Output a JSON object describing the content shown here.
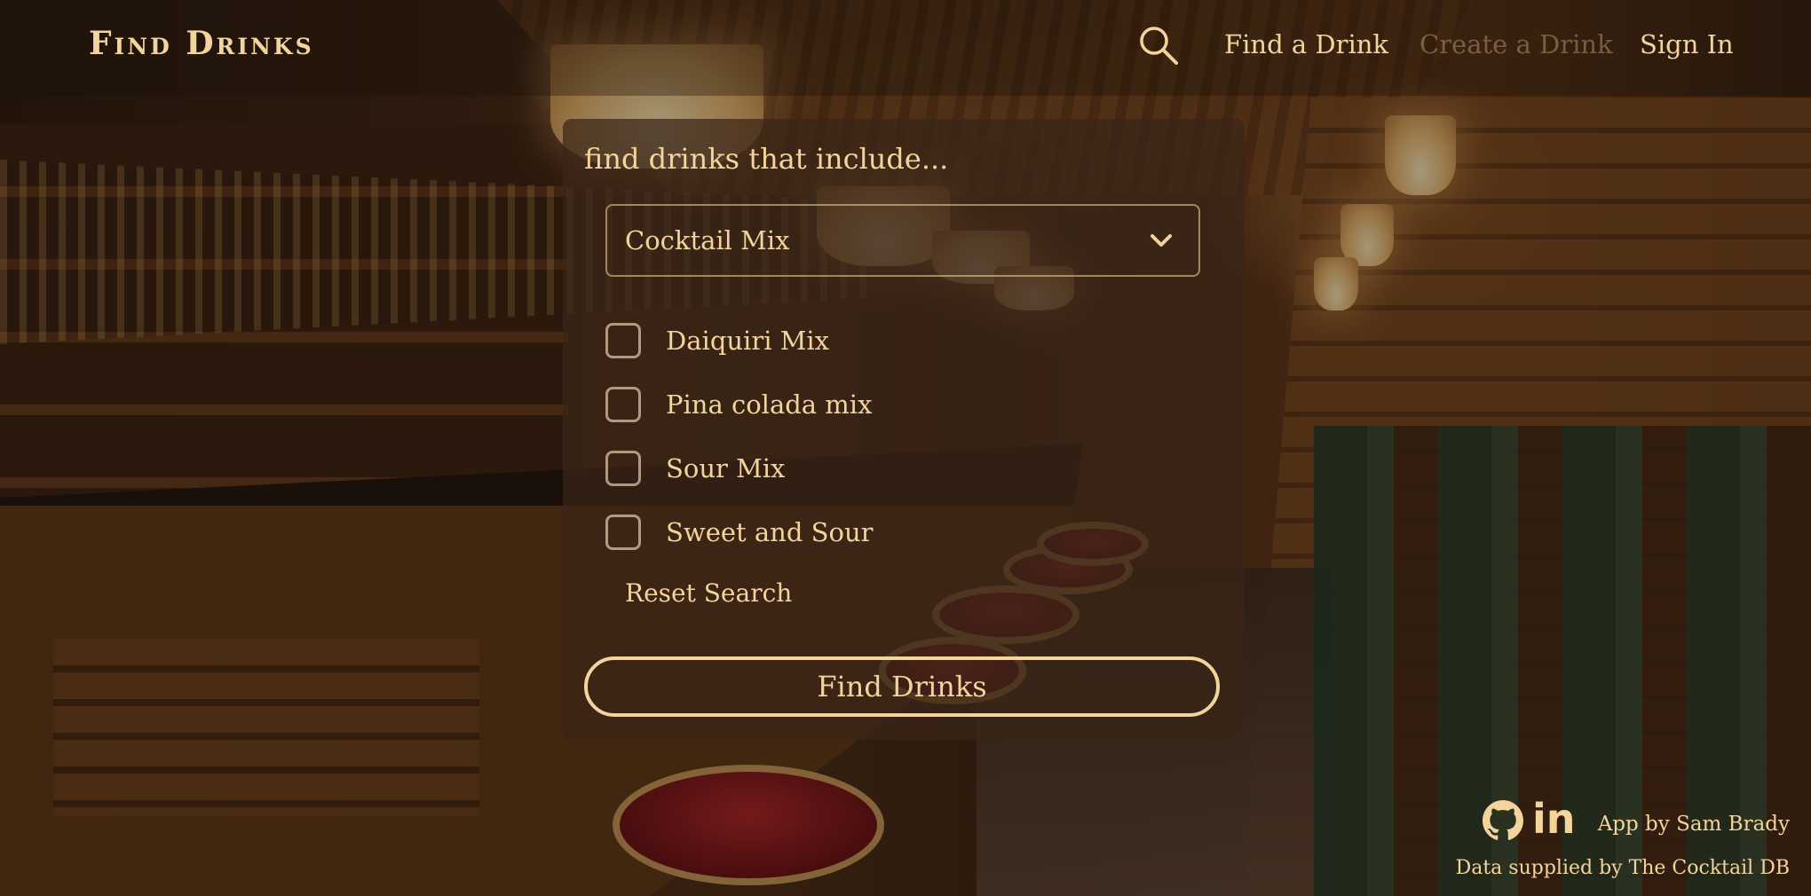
{
  "header": {
    "logo": "Find Drinks",
    "nav": [
      {
        "label": "Find a Drink"
      },
      {
        "label": "Create a Drink"
      },
      {
        "label": "Sign In"
      }
    ]
  },
  "search": {
    "title": "find drinks that include...",
    "category": {
      "selected": "Cocktail Mix"
    },
    "ingredients": [
      {
        "label": "Daiquiri Mix",
        "checked": false
      },
      {
        "label": "Pina colada mix",
        "checked": false
      },
      {
        "label": "Sour Mix",
        "checked": false
      },
      {
        "label": "Sweet and Sour",
        "checked": false
      }
    ],
    "reset_label": "Reset Search",
    "submit_label": "Find Drinks"
  },
  "footer": {
    "linkedin": "in",
    "credit": "App by Sam Brady",
    "data_source": "Data supplied by The Cocktail DB"
  },
  "colors": {
    "accent": "#f3d49c",
    "panel": "#3a2618"
  },
  "icons": [
    "search-icon",
    "chevron-down-icon",
    "github-icon",
    "linkedin-icon"
  ]
}
